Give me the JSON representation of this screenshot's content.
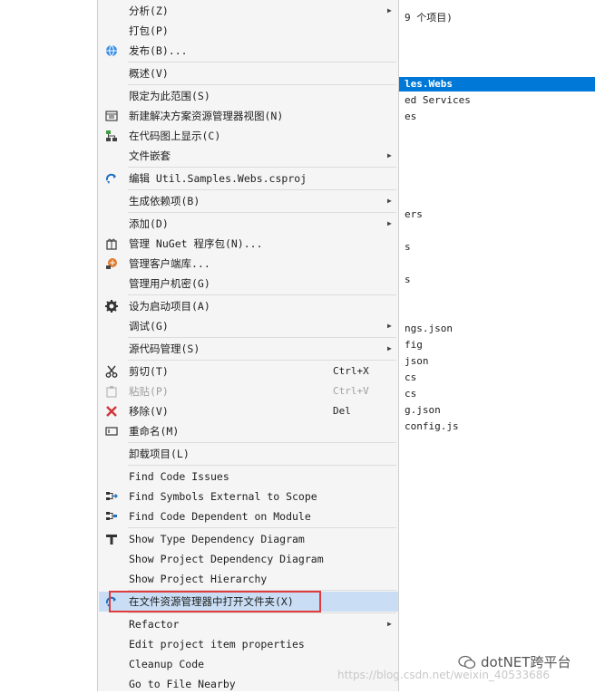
{
  "background_panel": {
    "lines": [
      {
        "text": "9 个项目)"
      },
      {
        "text": "les.Webs",
        "selected": true
      },
      {
        "text": "ed Services"
      },
      {
        "text": "es"
      },
      {
        "text": "ers"
      },
      {
        "text": "s"
      },
      {
        "text": "s"
      },
      {
        "text": "ngs.json"
      },
      {
        "text": "fig"
      },
      {
        "text": "json"
      },
      {
        "text": "cs"
      },
      {
        "text": "cs"
      },
      {
        "text": "g.json"
      },
      {
        "text": "config.js"
      }
    ]
  },
  "menu": {
    "items": [
      {
        "label": "分析(Z)",
        "arrow": "▶"
      },
      {
        "label": "打包(P)"
      },
      {
        "label": "发布(B)...",
        "icon": "globe-icon"
      },
      {
        "label": "概述(V)"
      },
      {
        "label": "限定为此范围(S)"
      },
      {
        "label": "新建解决方案资源管理器视图(N)",
        "icon": "new-view-icon"
      },
      {
        "label": "在代码图上显示(C)",
        "icon": "code-map-icon"
      },
      {
        "label": "文件嵌套",
        "arrow": "▶"
      },
      {
        "label": "编辑 Util.Samples.Webs.csproj",
        "icon": "edit-project-icon"
      },
      {
        "label": "生成依赖项(B)",
        "arrow": "▶"
      },
      {
        "label": "添加(D)",
        "arrow": "▶"
      },
      {
        "label": "管理 NuGet 程序包(N)...",
        "icon": "nuget-icon"
      },
      {
        "label": "管理客户端库...",
        "icon": "client-lib-icon"
      },
      {
        "label": "管理用户机密(G)"
      },
      {
        "label": "设为启动项目(A)",
        "icon": "gear-icon"
      },
      {
        "label": "调试(G)",
        "arrow": "▶"
      },
      {
        "label": "源代码管理(S)",
        "arrow": "▶"
      },
      {
        "label": "剪切(T)",
        "shortcut": "Ctrl+X",
        "icon": "scissors-icon"
      },
      {
        "label": "粘贴(P)",
        "shortcut": "Ctrl+V",
        "icon": "paste-icon",
        "disabled": true
      },
      {
        "label": "移除(V)",
        "shortcut": "Del",
        "icon": "remove-icon"
      },
      {
        "label": "重命名(M)",
        "icon": "rename-icon"
      },
      {
        "label": "卸载项目(L)"
      },
      {
        "label": "Find Code Issues"
      },
      {
        "label": "Find Symbols External to Scope",
        "icon": "symbols-external-icon"
      },
      {
        "label": "Find Code Dependent on Module",
        "icon": "code-dependent-icon"
      },
      {
        "label": "Show Type Dependency Diagram",
        "icon": "type-dependency-icon"
      },
      {
        "label": "Show Project Dependency Diagram"
      },
      {
        "label": "Show Project Hierarchy"
      },
      {
        "label": "在文件资源管理器中打开文件夹(X)",
        "icon": "open-folder-icon",
        "highlighted": true
      },
      {
        "label": "Refactor",
        "arrow": "▶"
      },
      {
        "label": "Edit project item properties"
      },
      {
        "label": "Cleanup Code"
      },
      {
        "label": "Go to File Nearby"
      }
    ]
  },
  "watermark": {
    "url": "https://blog.csdn.net/weixin_40533686",
    "brand": "dotNET跨平台"
  },
  "colors": {
    "menu_bg": "#f5f5f5",
    "highlight": "#c9def5",
    "selection_blue": "#0078d7",
    "annotation_red": "#e03c3c"
  }
}
